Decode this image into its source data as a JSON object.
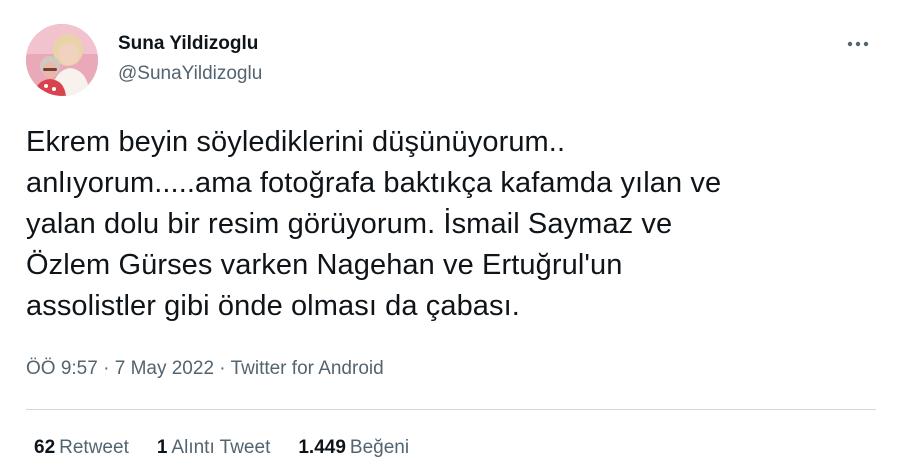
{
  "author": {
    "display_name": "Suna Yildizoglu",
    "handle": "@SunaYildizoglu"
  },
  "tweet": {
    "text": "Ekrem beyin söylediklerini düşünüyorum..\nanlıyorum.....ama fotoğrafa baktıkça kafamda yılan ve\nyalan dolu bir resim görüyorum. İsmail Saymaz ve\nÖzlem Gürses varken Nagehan ve Ertuğrul'un\nassolistler gibi önde olması da çabası."
  },
  "meta": {
    "time": "ÖÖ 9:57",
    "separator": " · ",
    "date": "7 May 2022",
    "source": "Twitter for Android"
  },
  "stats": {
    "retweets": {
      "count": "62",
      "label": "Retweet"
    },
    "quotes": {
      "count": "1",
      "label": "Alıntı Tweet"
    },
    "likes": {
      "count": "1.449",
      "label": "Beğeni"
    }
  },
  "icons": {
    "more": "more-horizontal-icon"
  },
  "colors": {
    "text_primary": "#0f1419",
    "text_secondary": "#536471",
    "divider": "#cfd9de",
    "avatar_bg": "#e8aab8"
  }
}
